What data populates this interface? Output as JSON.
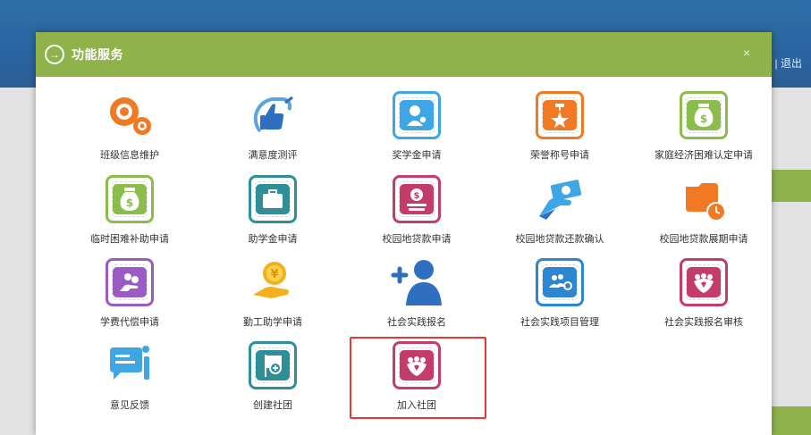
{
  "header": {
    "logout_label": "| 退出"
  },
  "modal": {
    "title": "功能服务",
    "close_glyph": "×",
    "title_icon_glyph": "→"
  },
  "tiles": [
    {
      "label": "班级信息维护"
    },
    {
      "label": "满意度测评"
    },
    {
      "label": "奖学金申请"
    },
    {
      "label": "荣誉称号申请"
    },
    {
      "label": "家庭经济困难认定申请"
    },
    {
      "label": "临时困难补助申请"
    },
    {
      "label": "助学金申请"
    },
    {
      "label": "校园地贷款申请"
    },
    {
      "label": "校园地贷款还款确认"
    },
    {
      "label": "校园地贷款展期申请"
    },
    {
      "label": "学费代偿申请"
    },
    {
      "label": "勤工助学申请"
    },
    {
      "label": "社会实践报名"
    },
    {
      "label": "社会实践项目管理"
    },
    {
      "label": "社会实践报名审核"
    },
    {
      "label": "意见反馈"
    },
    {
      "label": "创建社团"
    },
    {
      "label": "加入社团"
    }
  ],
  "colors": {
    "modal_header": "#8fb24b",
    "topbar": "#2f6fa8",
    "highlight": "#e53935",
    "orange": "#f07a24",
    "teal": "#2e8f99",
    "pink": "#c43c6a",
    "blue": "#3fa6e6",
    "green": "#8bbd4d",
    "purple": "#9a5bc2"
  },
  "icons": [
    "gears-icon",
    "thumbs-up-icon",
    "scholarship-user-icon",
    "medal-star-icon",
    "money-bag-icon",
    "money-bag-icon",
    "briefcase-icon",
    "coin-hand-icon",
    "cash-hand-icon",
    "calendar-clock-icon",
    "coins-hand-icon",
    "coin-hand-icon",
    "add-user-icon",
    "team-gear-icon",
    "community-heart-icon",
    "feedback-chat-icon",
    "flag-plus-icon",
    "community-heart-icon"
  ]
}
